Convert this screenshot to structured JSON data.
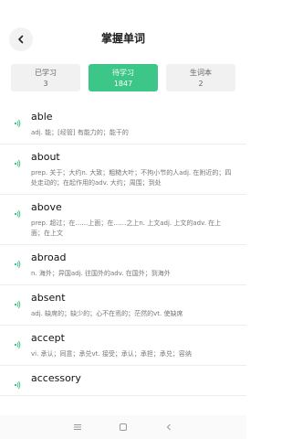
{
  "header": {
    "title": "掌握单词"
  },
  "tabs": [
    {
      "label": "已学习",
      "count": "3"
    },
    {
      "label": "待学习",
      "count": "1847"
    },
    {
      "label": "生词本",
      "count": "2"
    }
  ],
  "words": [
    {
      "word": "able",
      "meaning": "adj. 能；[经管] 有能力的；能干的"
    },
    {
      "word": "about",
      "meaning": "prep. 关于；大约n. 大致；粗糙大叶；不拘小节的人adj. 在附近的；四处走动的；在起作用的adv. 大约；周围；到处"
    },
    {
      "word": "above",
      "meaning": "prep. 超过；在……上面；在……之上n. 上文adj. 上文的adv. 在上面；在上文"
    },
    {
      "word": "abroad",
      "meaning": "n. 海外；异国adj. 往国外的adv. 在国外；到海外"
    },
    {
      "word": "absent",
      "meaning": "adj. 缺席的；缺少的；心不在焉的；茫然的vt. 使缺席"
    },
    {
      "word": "accept",
      "meaning": "vi. 承认；同意；承兑vt. 接受；承认；承担；承兑；容纳"
    },
    {
      "word": "accessory",
      "meaning": ""
    }
  ],
  "colors": {
    "accent": "#3cc688",
    "speaker": "#3cc688"
  },
  "icons": {
    "back": "chevron-left-icon",
    "speaker": "speaker-icon"
  }
}
